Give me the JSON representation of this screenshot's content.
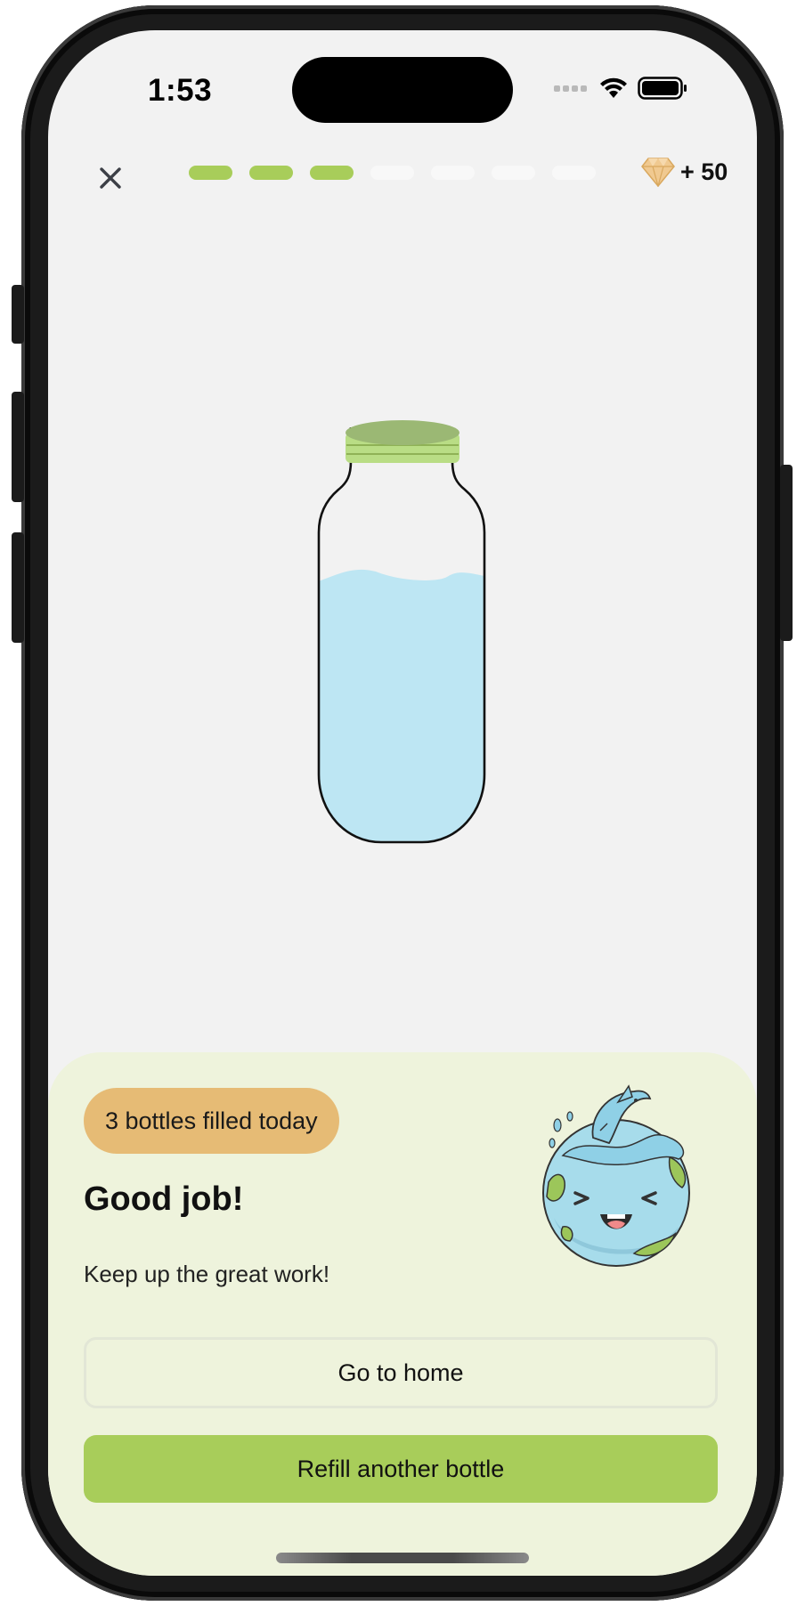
{
  "status_bar": {
    "time": "1:53"
  },
  "header": {
    "close_icon": "close-icon",
    "progress": {
      "completed": 3,
      "total": 7
    },
    "gems": {
      "icon": "diamond-icon",
      "text": "+ 50"
    }
  },
  "bottle": {
    "fill_level": 0.72,
    "water_color": "#bde6f3",
    "cap_color": "#a8cd5a"
  },
  "sheet": {
    "badge": "3 bottles filled today",
    "headline": "Good job!",
    "subtext": "Keep up the great work!",
    "illustration": "happy-earth-dolphin-illustration",
    "home_button": "Go to home",
    "refill_button": "Refill another bottle"
  },
  "colors": {
    "accent_green": "#a8cd5a",
    "badge_orange": "#e6bb75",
    "sheet_bg": "#eef3dc"
  }
}
